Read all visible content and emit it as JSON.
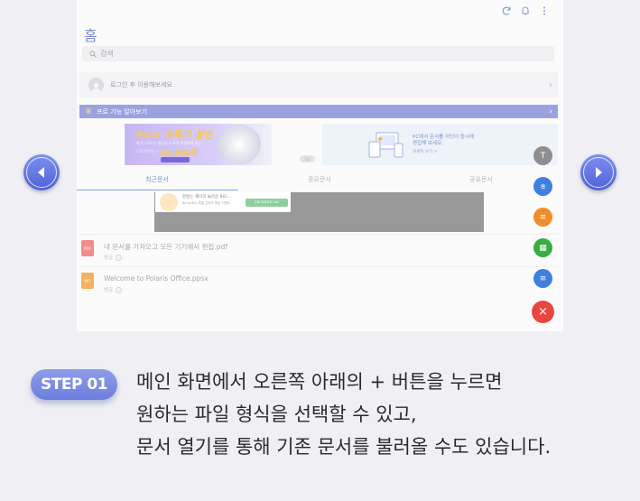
{
  "app": {
    "home_title": "홈",
    "search_placeholder": "검색",
    "login_text": "로그인 후 이용해보세요",
    "pro_banner": "프로 기능 알아보기",
    "promo": {
      "headline": "84% 초특가 할인",
      "subtitle": "마이그레이션 패키지 & 최대 특별혜택 제공",
      "old_price": "238,000원 →",
      "price": "36,900원"
    },
    "banner_pager": "1/2",
    "pc_banner": {
      "line1": "PC에서 문서를 어딘이 동시에",
      "line2": "편집해 보세요.",
      "more": "자세히 보기 >"
    },
    "tabs": [
      "최근문서",
      "중요문서",
      "공유문서"
    ],
    "ad": {
      "line1": "끝없는 재미의 놀라운 BIG...",
      "line2": "Bling Blip 특별 콘텐츠 제공 이벤트",
      "button": "무료 다운로드 Go!"
    },
    "files": [
      {
        "name": "내 문서를 가져오고 모든 기기에서 편집.pdf",
        "type": "PDF",
        "meta": "방금"
      },
      {
        "name": "Welcome to Polaris Office.ppsx",
        "type": "PPT",
        "meta": "방금"
      }
    ],
    "fabs": [
      {
        "label": "T",
        "color": "#8e8e8e"
      },
      {
        "label": "ㅎ",
        "color": "#3f7fe0"
      },
      {
        "label": "≡",
        "color": "#ef8d2a"
      },
      {
        "label": "▦",
        "color": "#36ae43"
      },
      {
        "label": "≡",
        "color": "#3f7fe0"
      },
      {
        "label": "×",
        "color": "#e8473e"
      }
    ]
  },
  "step": {
    "badge": "STEP 01",
    "lines": [
      "메인 화면에서 오른쪽 아래의 + 버튼을 누르면",
      "원하는 파일 형식을 선택할 수 있고,",
      "문서 열기를 통해 기존 문서를 불러올 수도 있습니다."
    ]
  },
  "icons": {
    "prev": "chevron-left-icon",
    "next": "chevron-right-icon",
    "sync": "sync-icon",
    "bell": "bell-icon",
    "more": "more-vertical-icon"
  },
  "colors": {
    "accent": "#6d7fde",
    "background": "#efeff4"
  }
}
